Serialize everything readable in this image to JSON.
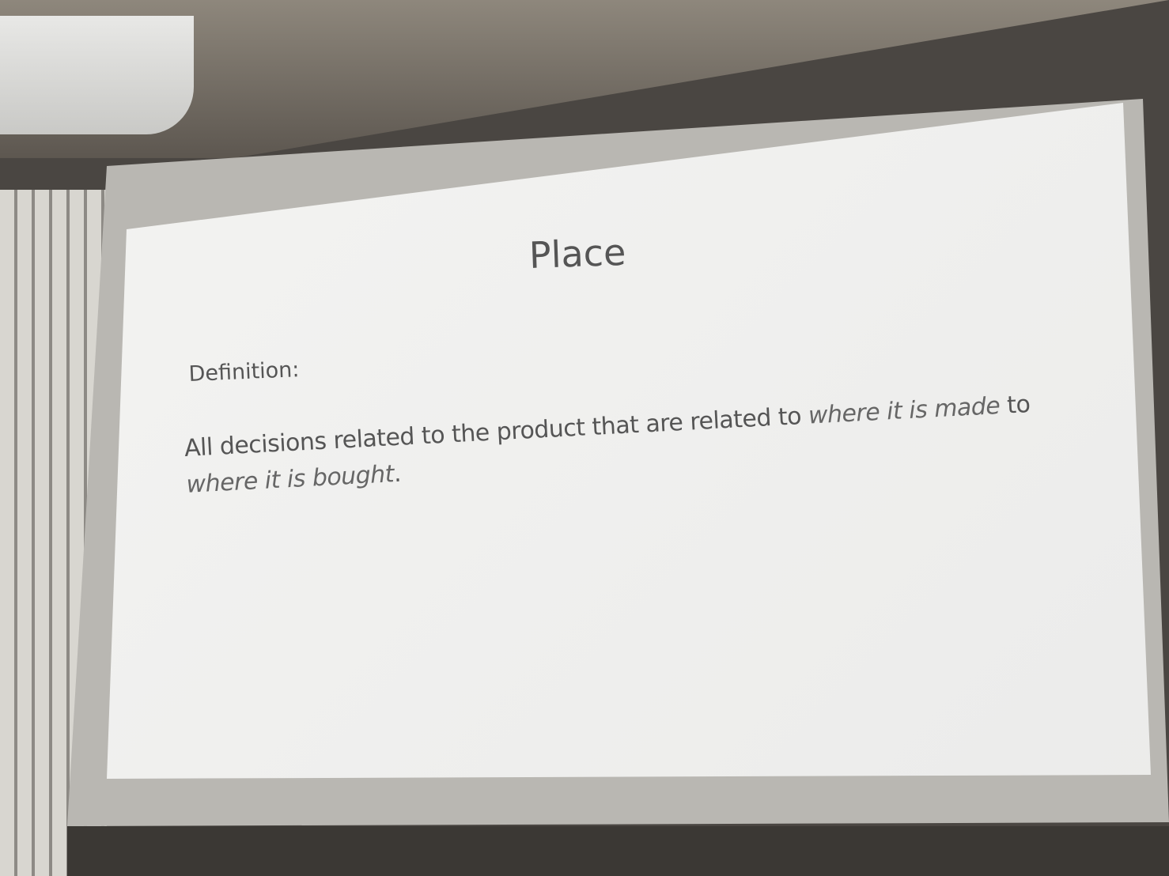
{
  "slide": {
    "title": "Place",
    "label": "Definition:",
    "text_plain_1": "All decisions related to the product that are related to ",
    "text_italic_1": "where it is made",
    "text_plain_2": " to ",
    "text_italic_2": "where it is bought",
    "text_end": "."
  }
}
